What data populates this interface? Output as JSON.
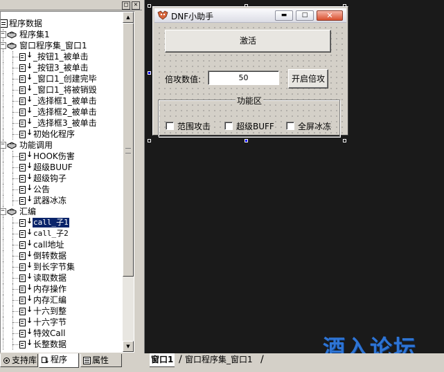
{
  "panel_header": {
    "minimize_glyph": "□",
    "close_glyph": "✕"
  },
  "tree": {
    "root": "程序数据",
    "items": [
      {
        "id": "prog-set-1",
        "label": "程序集1",
        "type": "set",
        "depth": 1
      },
      {
        "id": "window-set",
        "label": "窗口程序集_窗口1",
        "type": "set",
        "depth": 1
      },
      {
        "id": "btn1-click",
        "label": "_按钮1_被单击",
        "type": "sub",
        "depth": 2
      },
      {
        "id": "btn3-click",
        "label": "_按钮3_被单击",
        "type": "sub",
        "depth": 2
      },
      {
        "id": "win1-created",
        "label": "_窗口1_创建完毕",
        "type": "sub",
        "depth": 2
      },
      {
        "id": "win1-destroy",
        "label": "_窗口1_将被销毁",
        "type": "sub",
        "depth": 2
      },
      {
        "id": "chk1-click",
        "label": "_选择框1_被单击",
        "type": "sub",
        "depth": 2
      },
      {
        "id": "chk2-click",
        "label": "_选择框2_被单击",
        "type": "sub",
        "depth": 2
      },
      {
        "id": "chk3-click",
        "label": "_选择框3_被单击",
        "type": "sub",
        "depth": 2
      },
      {
        "id": "init-prog",
        "label": "初始化程序",
        "type": "sub",
        "depth": 2
      },
      {
        "id": "func-call",
        "label": "功能调用",
        "type": "set",
        "depth": 1
      },
      {
        "id": "hook-damage",
        "label": "HOOK伤害",
        "type": "sub",
        "depth": 2
      },
      {
        "id": "super-buff",
        "label": "超级BUUF",
        "type": "sub",
        "depth": 2
      },
      {
        "id": "super-hook",
        "label": "超级钩子",
        "type": "sub",
        "depth": 2
      },
      {
        "id": "announce",
        "label": "公告",
        "type": "sub",
        "depth": 2
      },
      {
        "id": "weapon-freeze",
        "label": "武器冰冻",
        "type": "sub",
        "depth": 2
      },
      {
        "id": "asm",
        "label": "汇编",
        "type": "set",
        "depth": 1
      },
      {
        "id": "call-sub1",
        "label": "call_子1",
        "type": "sub",
        "depth": 2,
        "selected": true,
        "mono": true
      },
      {
        "id": "call-sub2",
        "label": "call_子2",
        "type": "sub",
        "depth": 2,
        "mono": true
      },
      {
        "id": "call-addr",
        "label": "call地址",
        "type": "sub",
        "depth": 2
      },
      {
        "id": "reverse-data",
        "label": "倒转数据",
        "type": "sub",
        "depth": 2
      },
      {
        "id": "to-long-bytes",
        "label": "到长字节集",
        "type": "sub",
        "depth": 2
      },
      {
        "id": "read-data",
        "label": "读取数据",
        "type": "sub",
        "depth": 2
      },
      {
        "id": "mem-op",
        "label": "内存操作",
        "type": "sub",
        "depth": 2
      },
      {
        "id": "mem-asm",
        "label": "内存汇编",
        "type": "sub",
        "depth": 2
      },
      {
        "id": "hex-to-int",
        "label": "十六到整",
        "type": "sub",
        "depth": 2
      },
      {
        "id": "hex-bytes",
        "label": "十六字节",
        "type": "sub",
        "depth": 2
      },
      {
        "id": "effect-call",
        "label": "特效Call",
        "type": "sub",
        "depth": 2
      },
      {
        "id": "long-int-data",
        "label": "长整数据",
        "type": "sub",
        "depth": 2
      }
    ]
  },
  "left_tabs": [
    {
      "label": "支持库",
      "active": false
    },
    {
      "label": "程序",
      "active": true
    },
    {
      "label": "属性",
      "active": false
    }
  ],
  "dnf_window": {
    "title": "DNF小助手",
    "activate_button": "激活",
    "multiplier_label": "倍攻数值:",
    "multiplier_value": "50",
    "multiplier_button": "开启倍攻",
    "group_title": "功能区",
    "checkboxes": [
      "范围攻击",
      "超级BUFF",
      "全屏冰冻"
    ],
    "caption_glyphs": {
      "minimize": "▬",
      "maximize": "□",
      "close": "✕"
    }
  },
  "watermark": "酒入论坛",
  "design_tabs": [
    {
      "label": "窗口1",
      "active": true
    },
    {
      "label": "窗口程序集_窗口1",
      "active": false
    }
  ],
  "colors": {
    "selection": "#0a246a",
    "design_bg": "#1a1a1a",
    "watermark": "#2e74d4"
  }
}
